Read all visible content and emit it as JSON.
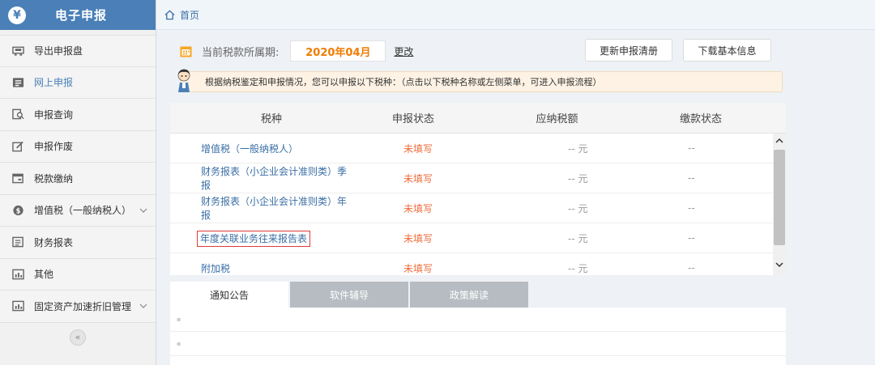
{
  "app": {
    "logo_symbol": "¥",
    "title": "电子申报"
  },
  "breadcrumb": {
    "home": "首页"
  },
  "sidebar": {
    "items": [
      {
        "label": "导出申报盘",
        "icon": "export-disk-icon",
        "active": false,
        "expandable": false
      },
      {
        "label": "网上申报",
        "icon": "online-declare-icon",
        "active": true,
        "expandable": false
      },
      {
        "label": "申报查询",
        "icon": "query-icon",
        "active": false,
        "expandable": false
      },
      {
        "label": "申报作废",
        "icon": "void-icon",
        "active": false,
        "expandable": false
      },
      {
        "label": "税款缴纳",
        "icon": "payment-icon",
        "active": false,
        "expandable": false
      },
      {
        "label": "增值税（一般纳税人）",
        "icon": "vat-icon",
        "active": false,
        "expandable": true
      },
      {
        "label": "财务报表",
        "icon": "report-icon",
        "active": false,
        "expandable": false
      },
      {
        "label": "其他",
        "icon": "chart-icon",
        "active": false,
        "expandable": false
      },
      {
        "label": "固定资产加速折旧管理",
        "icon": "chart-icon",
        "active": false,
        "expandable": true
      }
    ],
    "collapse_symbol": "«"
  },
  "period": {
    "label": "当前税款所属期:",
    "value": "2020年04月",
    "change": "更改"
  },
  "buttons": {
    "refresh_list": "更新申报清册",
    "download_info": "下载基本信息"
  },
  "tip": "根据纳税鉴定和申报情况，您可以申报以下税种：（点击以下税种名称或左侧菜单，可进入申报流程）",
  "table": {
    "headers": [
      "税种",
      "申报状态",
      "应纳税额",
      "缴款状态"
    ],
    "rows": [
      {
        "name": "增值税（一般纳税人）",
        "status": "未填写",
        "amount": "-- 元",
        "paid": "--",
        "highlight": false
      },
      {
        "name": "财务报表（小企业会计准则类）季报",
        "status": "未填写",
        "amount": "-- 元",
        "paid": "--",
        "highlight": false
      },
      {
        "name": "财务报表（小企业会计准则类）年报",
        "status": "未填写",
        "amount": "-- 元",
        "paid": "--",
        "highlight": false
      },
      {
        "name": "年度关联业务往来报告表",
        "status": "未填写",
        "amount": "-- 元",
        "paid": "--",
        "highlight": true
      },
      {
        "name": "附加税",
        "status": "未填写",
        "amount": "-- 元",
        "paid": "--",
        "highlight": false
      }
    ]
  },
  "tabs": [
    {
      "label": "通知公告",
      "active": true
    },
    {
      "label": "软件辅导",
      "active": false
    },
    {
      "label": "政策解读",
      "active": false
    }
  ],
  "notice_bullets": [
    "▪",
    "▪"
  ],
  "colors": {
    "brand": "#4a80b7",
    "status_unfilled": "#ef6b3a",
    "accent_orange": "#f07c00",
    "highlight_border": "#e03a3a"
  }
}
